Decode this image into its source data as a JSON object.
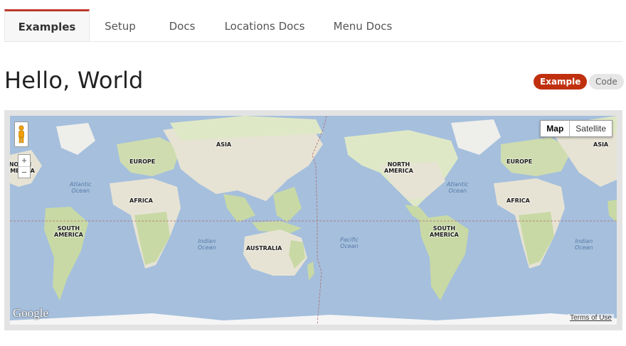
{
  "tabs": [
    {
      "label": "Examples",
      "active": true
    },
    {
      "label": "Setup"
    },
    {
      "label": "Docs"
    },
    {
      "label": "Locations Docs"
    },
    {
      "label": "Menu Docs"
    }
  ],
  "page": {
    "title": "Hello, World",
    "badge_example": "Example",
    "badge_code": "Code"
  },
  "map": {
    "type_map": "Map",
    "type_satellite": "Satellite",
    "zoom_in": "+",
    "zoom_out": "−",
    "logo": "Google",
    "terms": "Terms of Use",
    "labels": {
      "north_america_left": "NORTH\nAMERICA",
      "europe_1": "EUROPE",
      "asia_1": "ASIA",
      "africa_1": "AFRICA",
      "south_america_1": "SOUTH\nAMERICA",
      "australia": "AUSTRALIA",
      "north_america_2": "NORTH\nAMERICA",
      "europe_2": "EUROPE",
      "asia_2": "ASIA",
      "africa_2": "AFRICA",
      "south_america_2": "SOUTH\nAMERICA"
    },
    "oceans": {
      "atlantic_1": "Atlantic\nOcean",
      "indian_1": "Indian\nOcean",
      "pacific": "Pacific\nOcean",
      "atlantic_2": "Atlantic\nOcean",
      "indian_2": "Indian\nOcean"
    },
    "colors": {
      "water": "#a5bfdd",
      "land": "#e7e3d4",
      "vegetation": "#c8d9a5",
      "accent": "#c0300f"
    }
  }
}
